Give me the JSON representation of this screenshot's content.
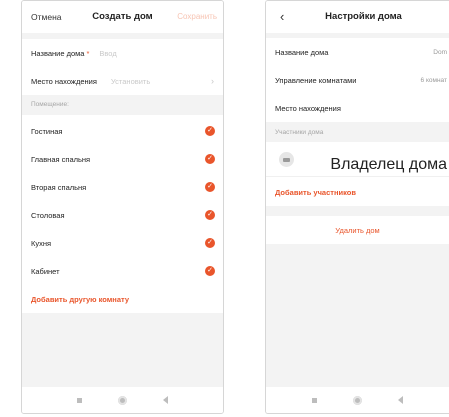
{
  "left_screen": {
    "header": {
      "cancel": "Отмена",
      "title": "Создать дом",
      "save": "Сохранить"
    },
    "home_name": {
      "label": "Название дома",
      "required_mark": "*",
      "placeholder": "Ввод"
    },
    "location": {
      "label": "Место нахождения",
      "placeholder": "Установить",
      "chevron": "›"
    },
    "rooms_section_label": "Помещение:",
    "rooms": [
      {
        "name": "Гостиная",
        "checked": true
      },
      {
        "name": "Главная спальня",
        "checked": true
      },
      {
        "name": "Вторая спальня",
        "checked": true
      },
      {
        "name": "Столовая",
        "checked": true
      },
      {
        "name": "Кухня",
        "checked": true
      },
      {
        "name": "Кабинет",
        "checked": true
      }
    ],
    "check_glyph": "✓",
    "add_room": "Добавить другую комнату"
  },
  "right_screen": {
    "header": {
      "back": "‹",
      "title": "Настройки дома"
    },
    "home_name": {
      "label": "Название дома",
      "value": "Dom"
    },
    "room_management": {
      "label": "Управление комнатами",
      "value": "6 комнат"
    },
    "location": {
      "label": "Место нахождения"
    },
    "members_section_label": "Участники дома",
    "member": {
      "role": "Владелец дома"
    },
    "add_members": "Добавить участников",
    "delete_home": "Удалить дом"
  },
  "colors": {
    "accent": "#e9552b",
    "background_gray": "#f3f3f3"
  },
  "icons": [
    "check-icon",
    "chevron-right-icon",
    "back-arrow-icon",
    "avatar-icon",
    "nav-square-icon",
    "nav-home-icon",
    "nav-back-icon"
  ]
}
